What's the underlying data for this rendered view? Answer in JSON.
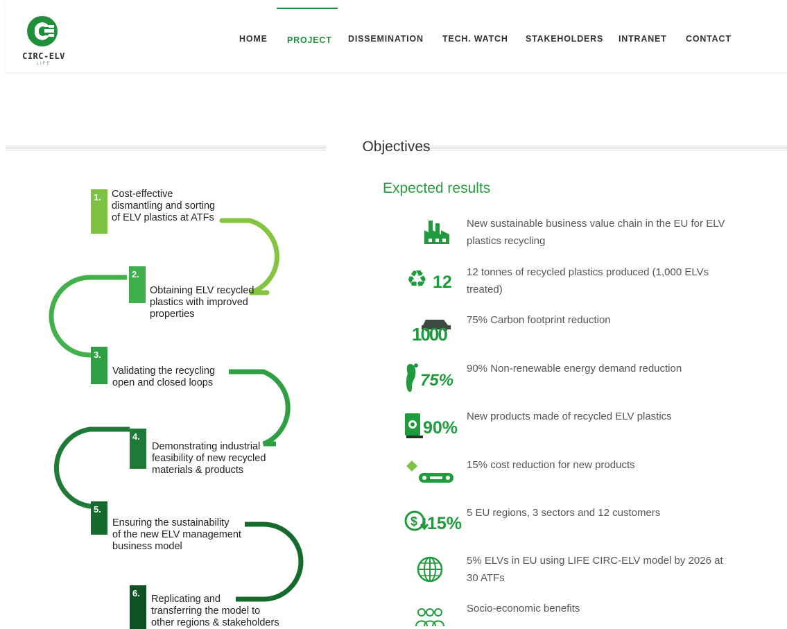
{
  "logo": {
    "name": "CIRC-ELV",
    "sub": "LIFE"
  },
  "nav": {
    "items": [
      {
        "label": "HOME"
      },
      {
        "label": "PROJECT"
      },
      {
        "label": "DISSEMINATION"
      },
      {
        "label": "TECH. WATCH"
      },
      {
        "label": "STAKEHOLDERS"
      },
      {
        "label": "INTRANET"
      },
      {
        "label": "CONTACT"
      }
    ],
    "active": "PROJECT"
  },
  "objectives": {
    "title": "Objectives"
  },
  "steps": [
    {
      "num": "1.",
      "text": [
        "Cost-effective",
        "dismantling and sorting",
        "of ELV plastics at ATFs"
      ],
      "color": "#7dc242"
    },
    {
      "num": "2.",
      "text": [
        "Obtaining ELV recycled",
        "plastics with improved",
        "properties"
      ],
      "color": "#3db04a"
    },
    {
      "num": "3.",
      "text": [
        "Validating the recycling",
        "open and closed loops"
      ],
      "color": "#2ea043"
    },
    {
      "num": "4.",
      "text": [
        "Demonstrating industrial",
        "feasibility of new recycled",
        "materials & products"
      ],
      "color": "#1e7a36"
    },
    {
      "num": "5.",
      "text": [
        "Ensuring the sustainability",
        "of the new ELV management",
        "business model"
      ],
      "color": "#176a2e"
    },
    {
      "num": "6.",
      "text": [
        "Replicating and",
        "transferring the model to",
        "other regions & stakeholders"
      ],
      "color": "#0f5224"
    }
  ],
  "results": {
    "title": "Expected results",
    "items": [
      {
        "icon": "factory-icon",
        "badge": "",
        "text": "New sustainable business value chain in the EU for ELV plastics recycling"
      },
      {
        "icon": "recycle-icon",
        "badge": "12",
        "text": "12 tonnes of recycled plastics produced (1,000 ELVs treated)"
      },
      {
        "icon": "car-icon",
        "badge": "1000",
        "text": "75% Carbon footprint reduction"
      },
      {
        "icon": "leaf-footprint-icon",
        "badge": "75%",
        "text": "90% Non-renewable energy demand reduction"
      },
      {
        "icon": "fuel-pump-icon",
        "badge": "90%",
        "text": "New products made of recycled ELV plastics"
      },
      {
        "icon": "car-parts-icon",
        "badge": "",
        "text": "15% cost reduction for new products"
      },
      {
        "icon": "dollar-down-icon",
        "badge": "15%",
        "text": "5 EU regions, 3 sectors and 12 customers"
      },
      {
        "icon": "globe-icon",
        "badge": "",
        "text": "5% ELVs in EU using LIFE CIRC-ELV model by 2026 at 30 ATFs"
      },
      {
        "icon": "people-icon",
        "badge": "",
        "text": "Socio-economic benefits"
      }
    ]
  },
  "colors": {
    "brand_green": "#1f8f3a",
    "light_green": "#7dc242",
    "dark_green": "#0f5224"
  }
}
